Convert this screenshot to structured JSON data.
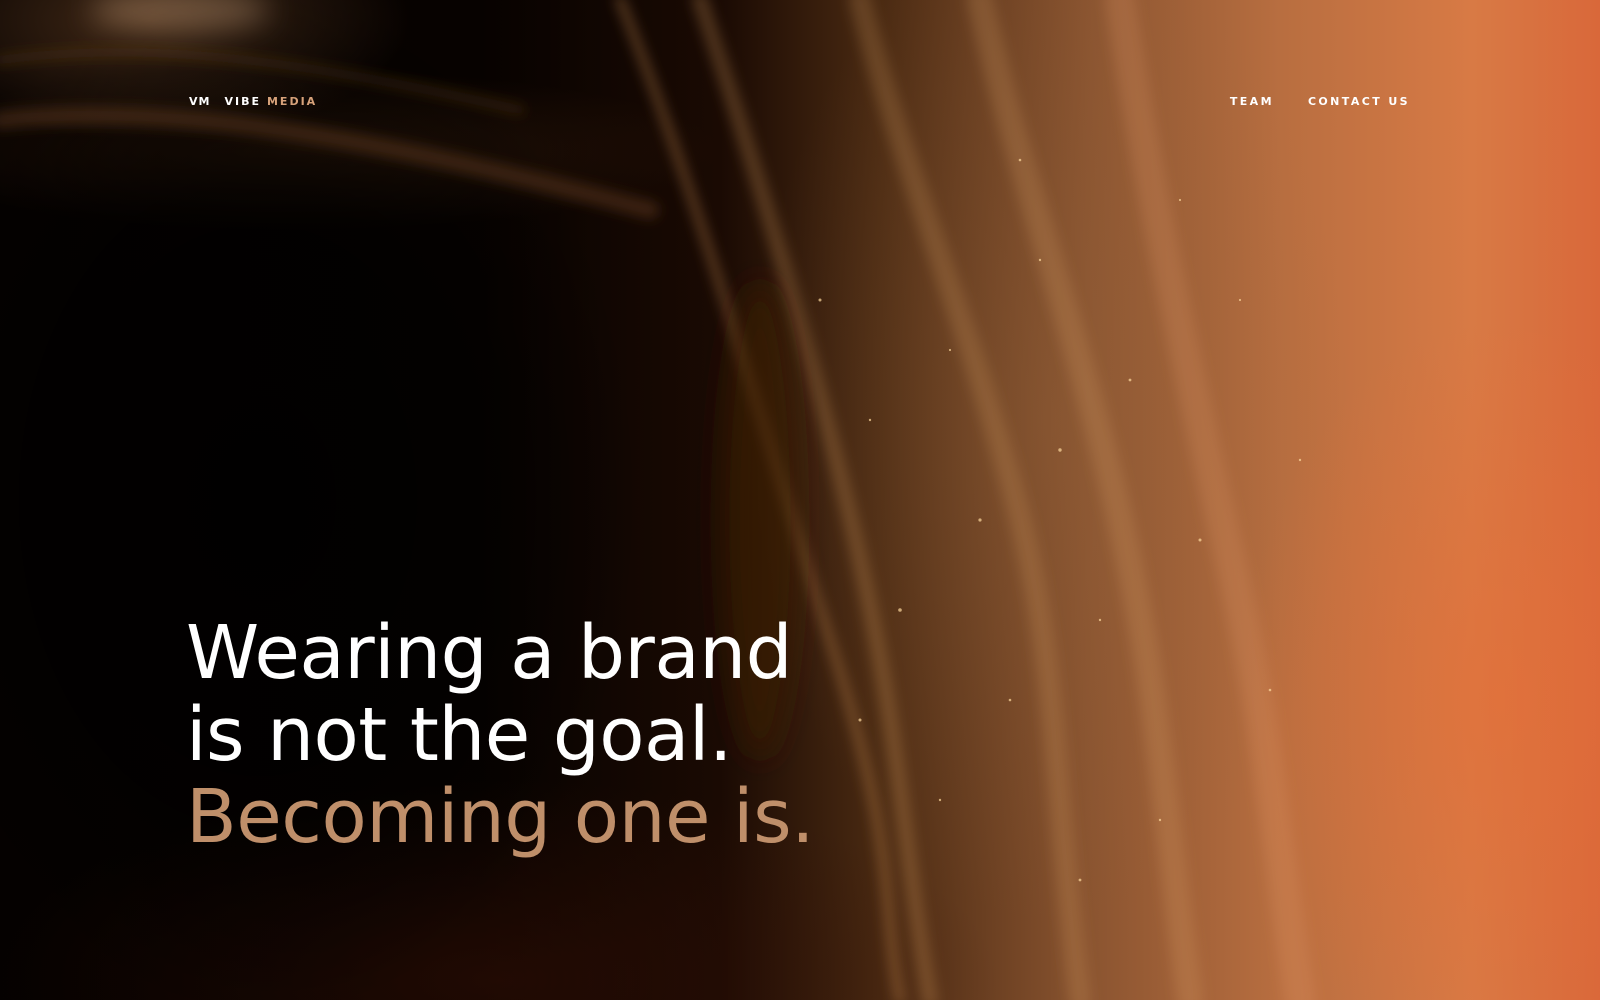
{
  "brand": {
    "mark": "VM",
    "name_primary": "VIBE",
    "name_accent": "MEDIA"
  },
  "nav": {
    "items": [
      {
        "label": "TEAM"
      },
      {
        "label": "CONTACT US"
      }
    ]
  },
  "hero": {
    "line1": "Wearing a brand",
    "line2": "is not the goal.",
    "line3": "Becoming one is."
  },
  "colors": {
    "accent": "#d7a27a",
    "headline_secondary": "#bf8f6a",
    "background_dark": "#050200",
    "background_orange": "#d9683a"
  }
}
